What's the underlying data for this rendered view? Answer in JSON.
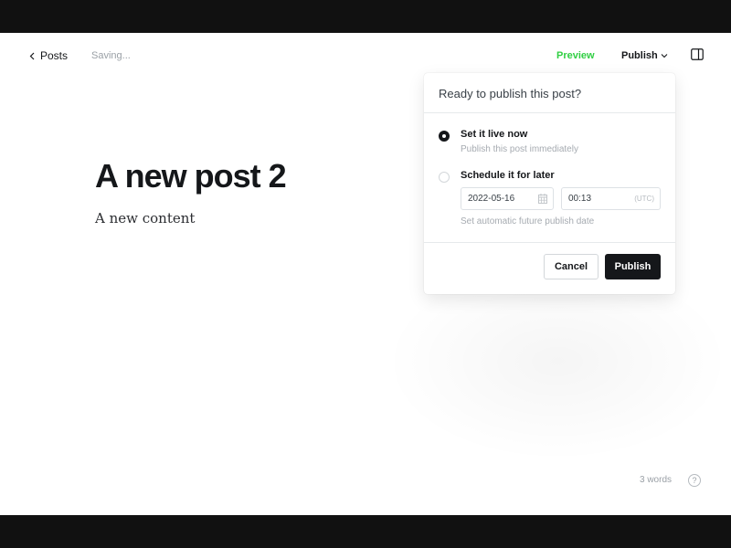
{
  "header": {
    "back_label": "Posts",
    "status": "Saving...",
    "preview_label": "Preview",
    "publish_label": "Publish"
  },
  "post": {
    "title": "A new post 2",
    "content": "A new content"
  },
  "publish_popover": {
    "heading": "Ready to publish this post?",
    "option_now": {
      "label": "Set it live now",
      "description": "Publish this post immediately",
      "selected": true
    },
    "option_later": {
      "label": "Schedule it for later",
      "selected": false,
      "date_value": "2022-05-16",
      "time_value": "00:13",
      "timezone": "(UTC)",
      "note": "Set automatic future publish date"
    },
    "cancel_label": "Cancel",
    "publish_label": "Publish"
  },
  "footer": {
    "word_count": "3 words",
    "help_glyph": "?"
  },
  "colors": {
    "accent_green": "#30cf43",
    "primary_dark": "#15171a",
    "muted": "#9aa0a6"
  },
  "icons": [
    "chevron-left-icon",
    "chevron-down-icon",
    "sidebar-toggle-icon",
    "calendar-icon",
    "help-icon"
  ]
}
